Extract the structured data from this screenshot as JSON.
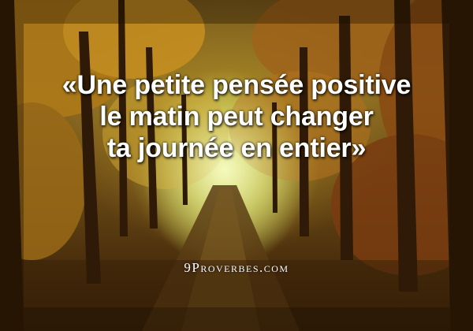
{
  "image": {
    "subject": "autumn forest path",
    "colors": {
      "foliage": "#c9931e",
      "light": "#eef6a8",
      "trunks": "#3a2208",
      "text": "#ffffff"
    }
  },
  "quote": {
    "lines": [
      "«Une petite pensée positive",
      "le matin peut changer",
      "ta journée en entier»"
    ]
  },
  "watermark": {
    "text": "9Proverbes.com"
  }
}
